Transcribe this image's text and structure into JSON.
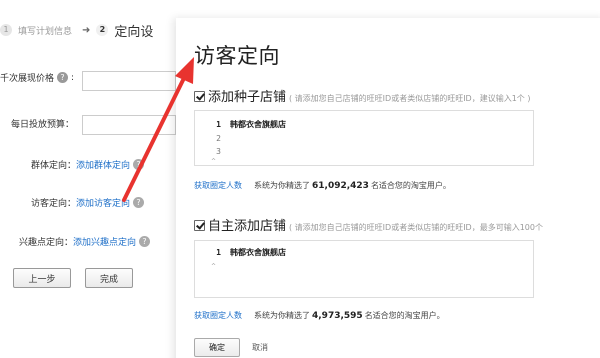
{
  "steps": {
    "step1_num": "1",
    "step1_label": "填写计划信息",
    "arrow": "➜",
    "step2_num": "2",
    "step2_label": "定向设"
  },
  "form": {
    "bid_label": "千次展现价格",
    "budget_label": "每日投放预算：",
    "group_label": "群体定向：",
    "group_link": "添加群体定向",
    "visitor_label": "访客定向：",
    "visitor_link": "添加访客定向",
    "interest_label": "兴趣点定向：",
    "interest_link": "添加兴趣点定向",
    "colon": ":",
    "help_glyph": "?",
    "prev_button": "上一步",
    "finish_button": "完成"
  },
  "modal": {
    "title": "访客定向",
    "seed": {
      "title": "添加种子店铺",
      "hint": "( 请添加您自己店铺的旺旺ID或者类似店铺的旺旺ID，建议输入1个 )",
      "lines": [
        {
          "num": "1",
          "text": "韩都衣舍旗舰店"
        },
        {
          "num": "2",
          "text": ""
        },
        {
          "num": "3",
          "text": ""
        }
      ],
      "caret": "^",
      "count_link": "获取圈定人数",
      "count_pre": "系统为你精选了",
      "count_value": "61,092,423",
      "count_post": "名适合您的淘宝用户。"
    },
    "custom": {
      "title": "自主添加店铺",
      "hint": "( 请添加您自己店铺的旺旺ID或者类似店铺的旺旺ID，最多可输入100个",
      "lines": [
        {
          "num": "1",
          "text": "韩都衣舍旗舰店"
        }
      ],
      "caret": "^",
      "count_link": "获取圈定人数",
      "count_pre": "系统为你精选了",
      "count_value": "4,973,595",
      "count_post": "名适合您的淘宝用户。"
    },
    "ok_button": "确定",
    "cancel_button": "取消"
  },
  "colors": {
    "link": "#1e6fc8",
    "annotation_arrow": "#e8332f"
  }
}
